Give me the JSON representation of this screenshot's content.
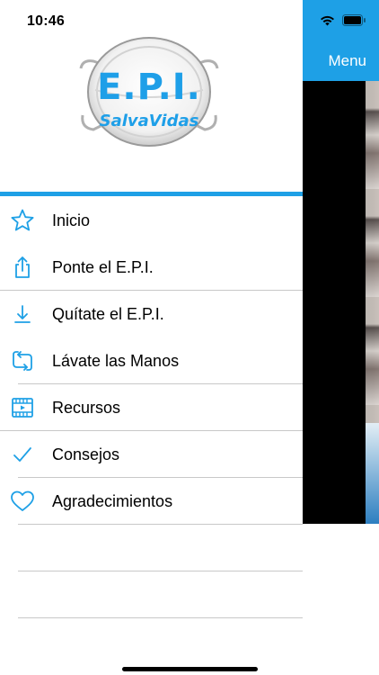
{
  "status_bar": {
    "time": "10:46"
  },
  "background_app": {
    "menu_label": "Menu"
  },
  "logo": {
    "line1": "E.P.I.",
    "line2": "SalvaVidas"
  },
  "menu": {
    "items": [
      {
        "label": "Inicio",
        "icon": "star-icon"
      },
      {
        "label": "Ponte el E.P.I.",
        "icon": "share-icon"
      },
      {
        "label": "Quítate el E.P.I.",
        "icon": "download-icon"
      },
      {
        "label": "Lávate las Manos",
        "icon": "repeat-icon"
      },
      {
        "label": "Recursos",
        "icon": "video-icon"
      },
      {
        "label": "Consejos",
        "icon": "checkmark-icon"
      },
      {
        "label": "Agradecimientos",
        "icon": "heart-icon"
      }
    ]
  },
  "colors": {
    "accent": "#1ea0e6",
    "separator": "#c8c8c8"
  }
}
